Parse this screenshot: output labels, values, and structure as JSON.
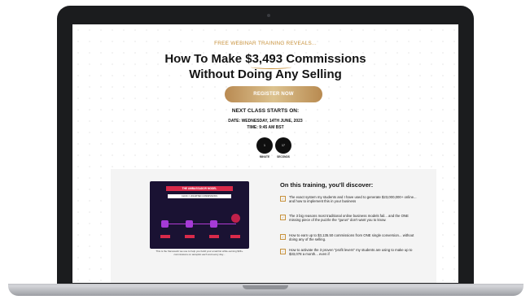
{
  "kicker": "FREE WEBINAR TRAINING REVEALS...",
  "headline": {
    "line1": "How To Make $3,493 Commissions",
    "line2": "Without Doing Any Selling"
  },
  "register_label": "REGISTER NOW",
  "next_class": "NEXT CLASS STARTS ON:",
  "date": "DATE: WEDNESDAY, 14TH JUNE, 2023",
  "time": "TIME: 9:45 AM BST",
  "countdown": [
    {
      "value": "1",
      "label": "MINUTE"
    },
    {
      "value": "17",
      "label": "SECONDS"
    }
  ],
  "video": {
    "title": "THE AMBASSADOR MODEL",
    "subtitle": "CLICK = UNLIMITED COMMISSIONS"
  },
  "caption": "This is the framework we use to help you build your email list while earning $3K+ commissions on autopilot each and every day...",
  "discover_title": "On this training, you'll discover:",
  "bullets": [
    "The exact system my students and I have used to generate $23,000,000+ online... and how to implement this in your business",
    "The 3 big reasons most traditional online business models fail... and the ONE missing piece of the puzzle the \"gurus\" don't want you to know.",
    "How to earn up to $3,135.50 commissions from ONE single conversion... without doing any of the selling.",
    "How to activate the 3 proven \"profit levers\" my students are using to make up to $33,078 a month... even if"
  ],
  "colors": {
    "gold": "#c8923c",
    "button_gradient": [
      "#b98a52",
      "#dcc28f"
    ],
    "video_bg": "#1a1233",
    "video_accent": "#d92a4a",
    "node": "#a53bd6"
  }
}
